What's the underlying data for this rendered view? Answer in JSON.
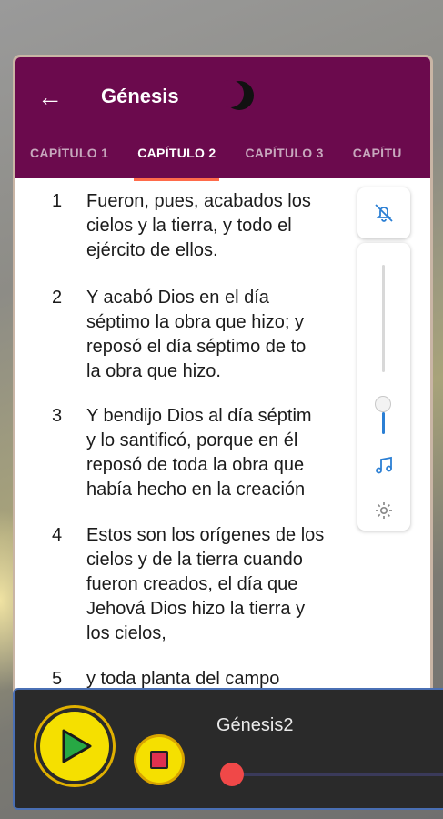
{
  "app": {
    "title": "Génesis",
    "back_icon": "arrow-left-icon",
    "theme_icon": "moon-icon"
  },
  "tabs": [
    {
      "label": "CAPÍTULO 1",
      "active": false
    },
    {
      "label": "CAPÍTULO 2",
      "active": true
    },
    {
      "label": "CAPÍTULO 3",
      "active": false
    },
    {
      "label": "CAPÍTU",
      "active": false
    }
  ],
  "verses": [
    {
      "num": "1",
      "lines": [
        "Fueron, pues, acabados los",
        "cielos y la tierra, y todo el",
        "ejército de ellos."
      ]
    },
    {
      "num": "2",
      "lines": [
        "Y acabó Dios en el día",
        "séptimo la obra que hizo; y",
        "reposó el día séptimo de to",
        "la obra que hizo."
      ]
    },
    {
      "num": "3",
      "lines": [
        "Y bendijo Dios al día séptim",
        "y lo santificó, porque en él",
        "reposó de toda la obra que",
        "había hecho en la creación"
      ]
    },
    {
      "num": "4",
      "lines": [
        "Estos son los orígenes de los",
        "cielos y de la tierra cuando",
        "fueron creados, el día que",
        "Jehová Dios hizo la tierra y",
        "los cielos,"
      ]
    },
    {
      "num": "5",
      "lines": [
        "y toda planta del campo"
      ]
    }
  ],
  "side_controls": {
    "mute_icon": "bell-off-icon",
    "volume_level": 0.35,
    "music_icon": "music-note-icon",
    "settings_icon": "gear-icon"
  },
  "player": {
    "track_title": "Génesis2",
    "play_icon": "play-icon",
    "stop_icon": "stop-icon",
    "progress": 0.0
  },
  "colors": {
    "appbar": "#6b0a4d",
    "accent": "#ff6b4a",
    "player_button": "#f5e000",
    "seek": "#f04848"
  }
}
